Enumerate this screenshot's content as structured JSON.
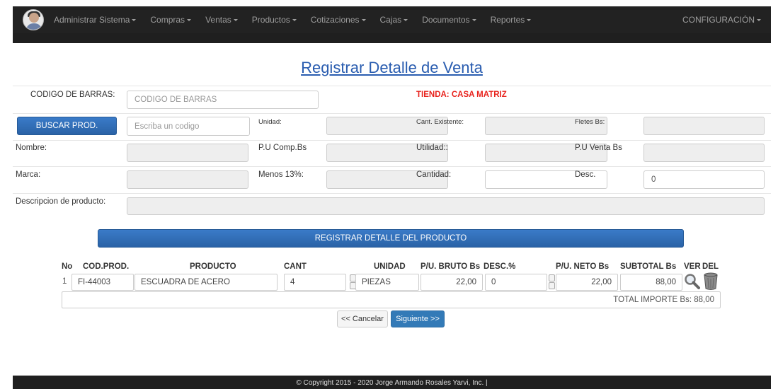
{
  "nav": {
    "items": [
      "Administrar Sistema",
      "Compras",
      "Ventas",
      "Productos",
      "Cotizaciones",
      "Cajas",
      "Documentos",
      "Reportes"
    ],
    "config": "CONFIGURACIÓN"
  },
  "page": {
    "title": "Registrar Detalle de Venta",
    "store": "TIENDA: CASA MATRIZ"
  },
  "form": {
    "barcode_label": "CODIGO DE BARRAS:",
    "barcode_placeholder": "CODIGO DE BARRAS",
    "search_button": "BUSCAR PROD.",
    "code_placeholder": "Escriba un codigo",
    "unidad_label": "Unidad:",
    "cant_existente_label": "Cant. Existente:",
    "fletes_label": "Fletes Bs:",
    "nombre_label": "Nombre:",
    "pu_comp_label": "P.U Comp.Bs",
    "utilidad_label": "Utilidad::",
    "pu_venta_label": "P.U Venta Bs",
    "marca_label": "Marca:",
    "menos13_label": "Menos 13%:",
    "cantidad_label": "Cantidad:",
    "desc_label": "Desc.",
    "desc_value": "0",
    "descripcion_label": "Descripcion de producto:",
    "register_button": "REGISTRAR DETALLE DEL PRODUCTO"
  },
  "table": {
    "headers": {
      "no": "No",
      "cod": "COD.PROD.",
      "producto": "PRODUCTO",
      "cant": "CANT",
      "unidad": "UNIDAD",
      "pu_bruto": "P/U. BRUTO Bs",
      "desc": "DESC.%",
      "pu_neto": "P/U. NETO Bs",
      "subtotal": "SUBTOTAL Bs",
      "ver": "VER",
      "del": "DEL"
    },
    "rows": [
      {
        "no": "1",
        "cod": "FI-44003",
        "producto": "ESCUADRA DE ACERO",
        "cant": "4",
        "unidad": "PIEZAS",
        "pu_bruto": "22,00",
        "desc": "0",
        "pu_neto": "22,00",
        "subtotal": "88,00"
      }
    ],
    "total": "TOTAL IMPORTE Bs: 88,00"
  },
  "actions": {
    "cancel": "<< Cancelar",
    "next": "Siguiente >>"
  },
  "footer": "© Copyright 2015 - 2020 Jorge Armando Rosales Yarvi, Inc. |",
  "colors": {
    "accent": "#2f6db5",
    "store": "#e8221c",
    "navbar": "#222222"
  }
}
